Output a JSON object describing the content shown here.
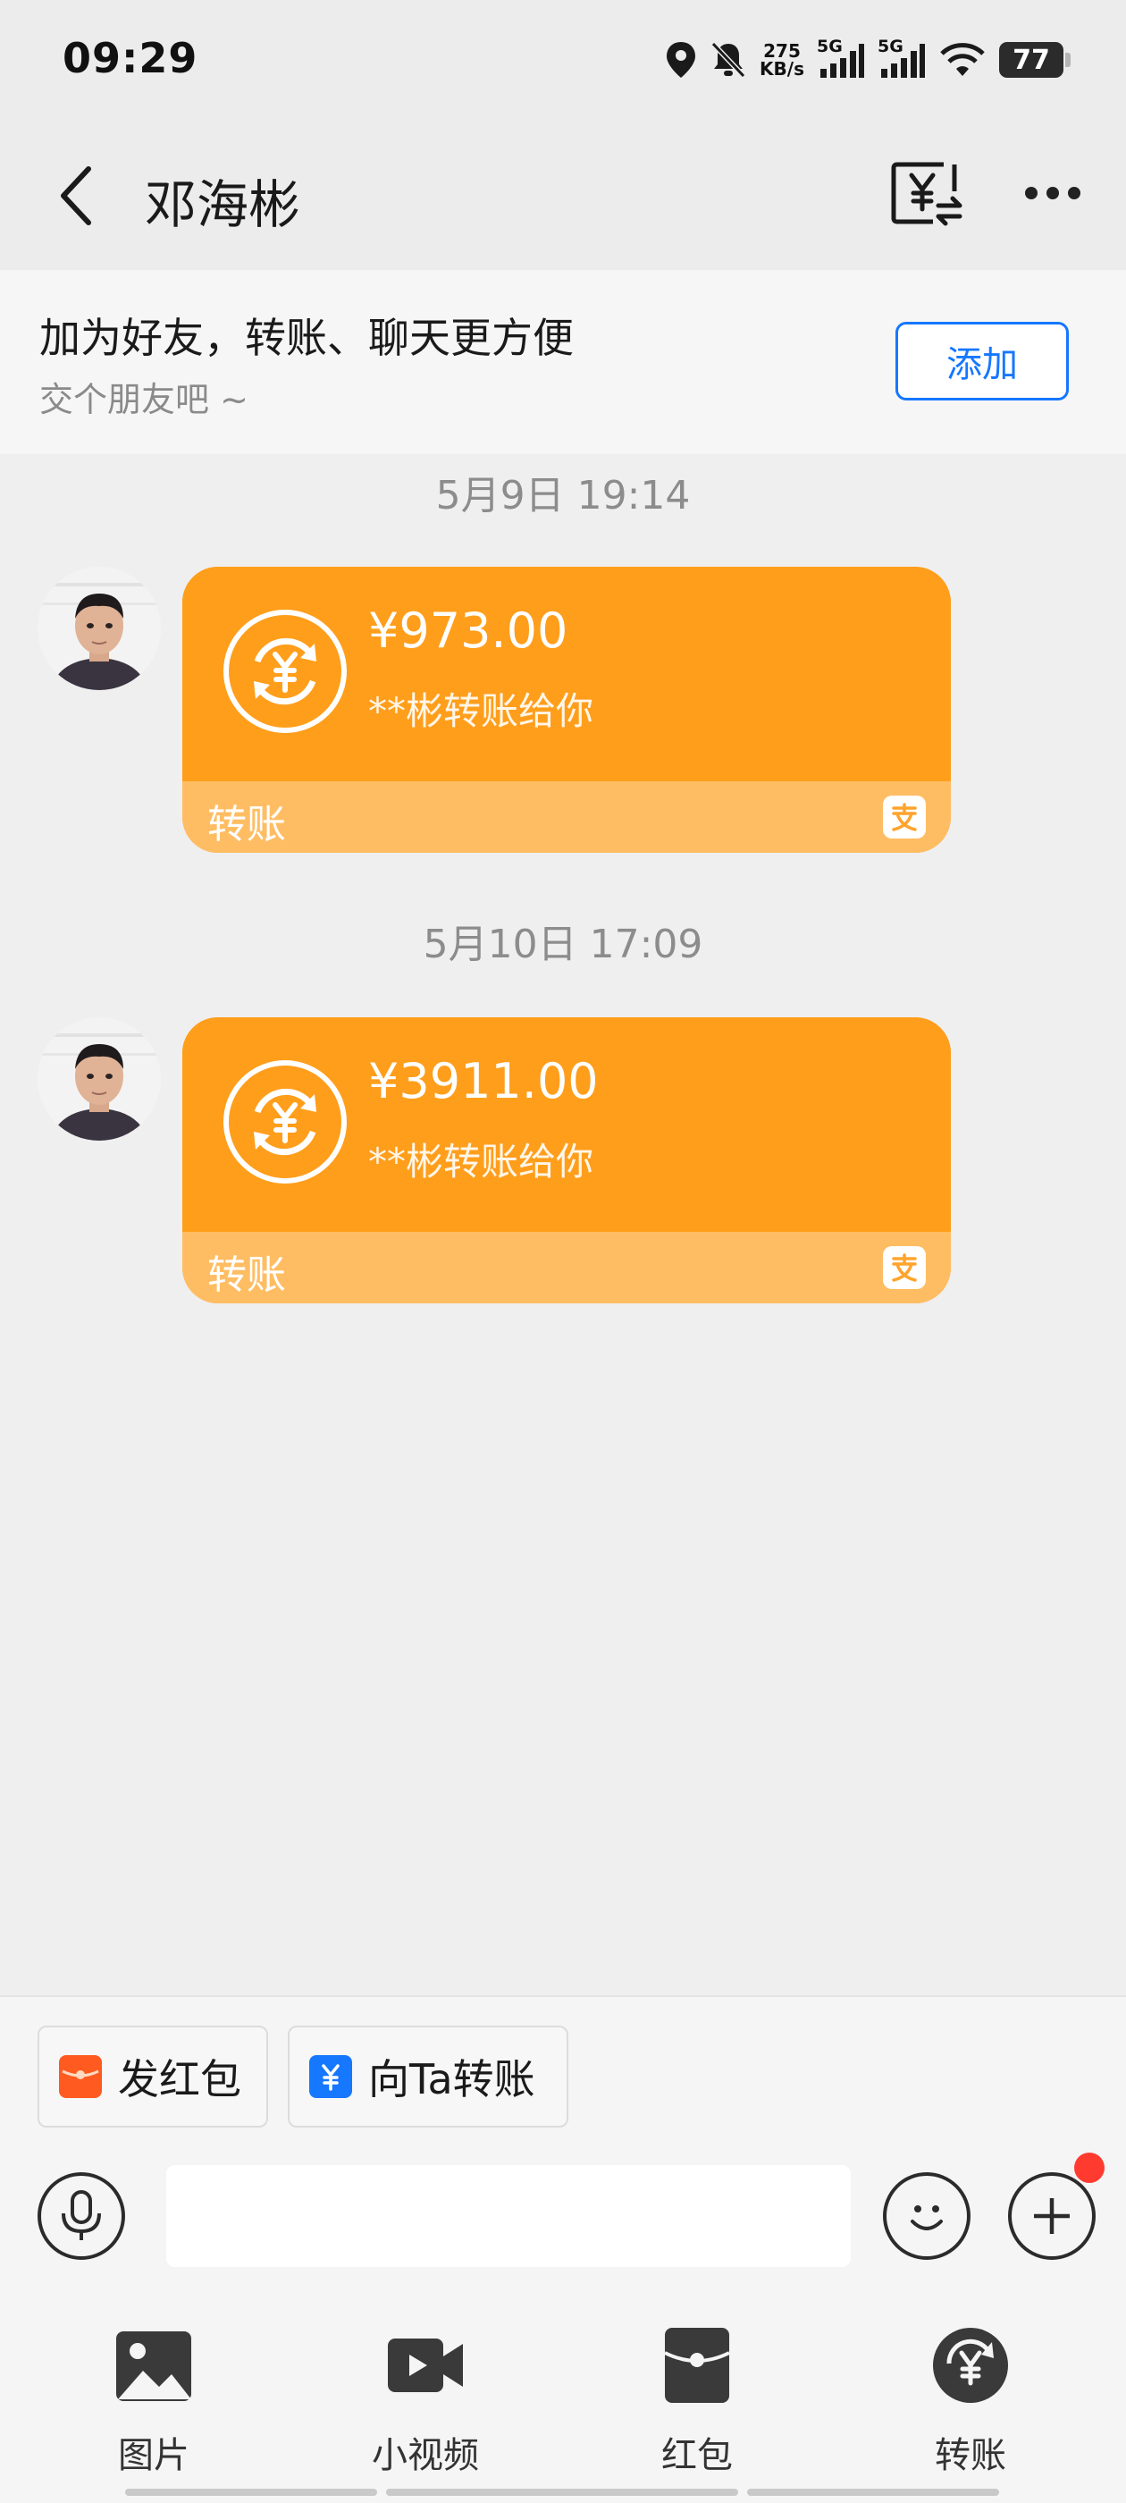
{
  "status_bar": {
    "time": "09:29",
    "net_speed_value": "275",
    "net_speed_unit": "KB/s",
    "signal1_label": "5G",
    "signal2_label": "5G",
    "battery": "77"
  },
  "header": {
    "title": "邓海彬"
  },
  "friend_banner": {
    "title": "加为好友，转账、聊天更方便",
    "subtitle": "交个朋友吧 ~",
    "add_label": "添加"
  },
  "messages": [
    {
      "timestamp": "5月9日 19:14",
      "amount": "¥973.00",
      "desc": "**彬转账给你",
      "label": "转账"
    },
    {
      "timestamp": "5月10日 17:09",
      "amount": "¥3911.00",
      "desc": "**彬转账给你",
      "label": "转账"
    }
  ],
  "quick_actions": {
    "red_packet": "发红包",
    "transfer": "向Ta转账"
  },
  "input": {
    "placeholder": ""
  },
  "toolbar": [
    {
      "label": "图片",
      "icon": "image-icon"
    },
    {
      "label": "小视频",
      "icon": "video-icon"
    },
    {
      "label": "红包",
      "icon": "red-packet-icon"
    },
    {
      "label": "转账",
      "icon": "transfer-icon"
    }
  ],
  "colors": {
    "card_orange": "#ff9e1b",
    "card_footer": "#ffbd63",
    "accent_blue": "#1677ff",
    "notification_red": "#ff3b2f"
  }
}
